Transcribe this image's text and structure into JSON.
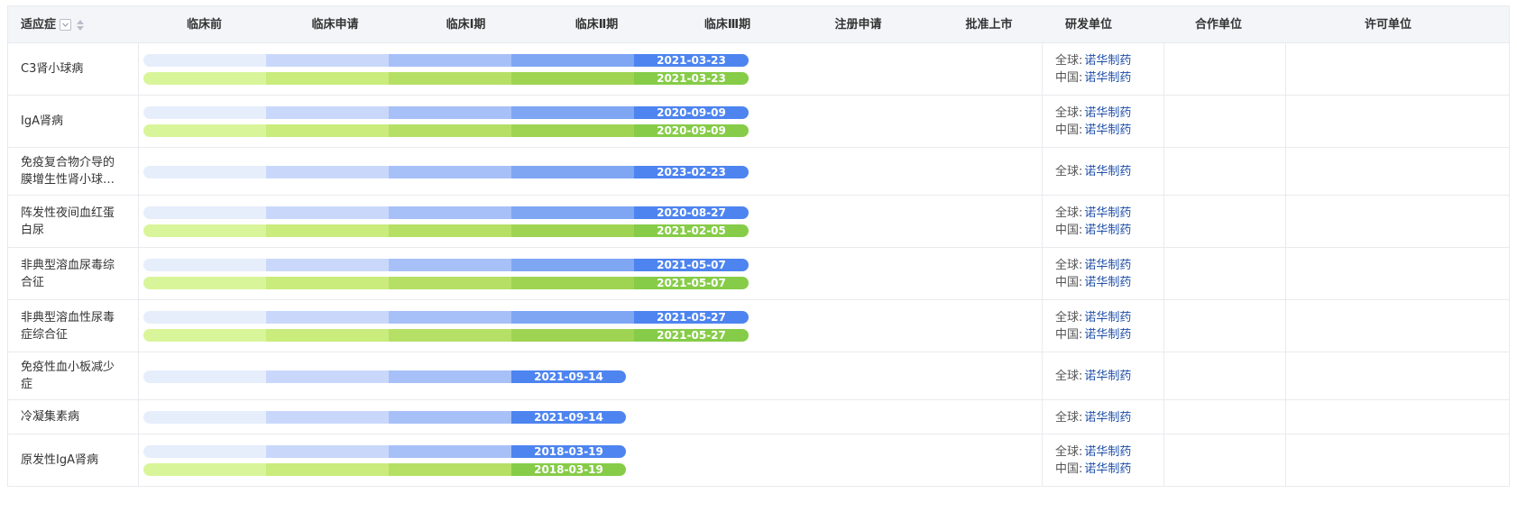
{
  "header": {
    "indication": "适应症",
    "filter_icon": "filter-icon",
    "sort_icon": "sort-icon",
    "stages": [
      "临床前",
      "临床申请",
      "临床Ⅰ期",
      "临床Ⅱ期",
      "临床Ⅲ期",
      "注册申请",
      "批准上市"
    ],
    "developer": "研发单位",
    "partner": "合作单位",
    "licensor": "许可单位"
  },
  "colors": {
    "blue": [
      "#e6eefc",
      "#c9d8fa",
      "#a7c0f7",
      "#7ea6f3",
      "#4d84f0"
    ],
    "green": [
      "#d9f59a",
      "#c9ec7c",
      "#b5e065",
      "#9fd453",
      "#86cc48"
    ],
    "link": "#1f4fa8"
  },
  "rows": [
    {
      "name": "C3肾小球病",
      "bars": [
        {
          "color": "blue",
          "stage": 5,
          "date": "2021-03-23"
        },
        {
          "color": "green",
          "stage": 5,
          "date": "2021-03-23"
        }
      ],
      "dev": [
        {
          "label": "全球:",
          "company": "诺华制药"
        },
        {
          "label": "中国:",
          "company": "诺华制药"
        }
      ]
    },
    {
      "name": "IgA肾病",
      "bars": [
        {
          "color": "blue",
          "stage": 5,
          "date": "2020-09-09"
        },
        {
          "color": "green",
          "stage": 5,
          "date": "2020-09-09"
        }
      ],
      "dev": [
        {
          "label": "全球:",
          "company": "诺华制药"
        },
        {
          "label": "中国:",
          "company": "诺华制药"
        }
      ]
    },
    {
      "name": "免疫复合物介导的膜增生性肾小球肾炎",
      "bars": [
        {
          "color": "blue",
          "stage": 5,
          "date": "2023-02-23"
        }
      ],
      "dev": [
        {
          "label": "全球:",
          "company": "诺华制药"
        }
      ]
    },
    {
      "name": "阵发性夜间血红蛋白尿",
      "bars": [
        {
          "color": "blue",
          "stage": 5,
          "date": "2020-08-27"
        },
        {
          "color": "green",
          "stage": 5,
          "date": "2021-02-05"
        }
      ],
      "dev": [
        {
          "label": "全球:",
          "company": "诺华制药"
        },
        {
          "label": "中国:",
          "company": "诺华制药"
        }
      ]
    },
    {
      "name": "非典型溶血尿毒综合征",
      "bars": [
        {
          "color": "blue",
          "stage": 5,
          "date": "2021-05-07"
        },
        {
          "color": "green",
          "stage": 5,
          "date": "2021-05-07"
        }
      ],
      "dev": [
        {
          "label": "全球:",
          "company": "诺华制药"
        },
        {
          "label": "中国:",
          "company": "诺华制药"
        }
      ]
    },
    {
      "name": "非典型溶血性尿毒症综合征",
      "bars": [
        {
          "color": "blue",
          "stage": 5,
          "date": "2021-05-27"
        },
        {
          "color": "green",
          "stage": 5,
          "date": "2021-05-27"
        }
      ],
      "dev": [
        {
          "label": "全球:",
          "company": "诺华制药"
        },
        {
          "label": "中国:",
          "company": "诺华制药"
        }
      ]
    },
    {
      "name": "免疫性血小板减少症",
      "bars": [
        {
          "color": "blue",
          "stage": 4,
          "date": "2021-09-14"
        }
      ],
      "dev": [
        {
          "label": "全球:",
          "company": "诺华制药"
        }
      ]
    },
    {
      "name": "冷凝集素病",
      "bars": [
        {
          "color": "blue",
          "stage": 4,
          "date": "2021-09-14"
        }
      ],
      "dev": [
        {
          "label": "全球:",
          "company": "诺华制药"
        }
      ]
    },
    {
      "name": "原发性IgA肾病",
      "bars": [
        {
          "color": "blue",
          "stage": 4,
          "date": "2018-03-19"
        },
        {
          "color": "green",
          "stage": 4,
          "date": "2018-03-19"
        }
      ],
      "dev": [
        {
          "label": "全球:",
          "company": "诺华制药"
        },
        {
          "label": "中国:",
          "company": "诺华制药"
        }
      ]
    }
  ]
}
